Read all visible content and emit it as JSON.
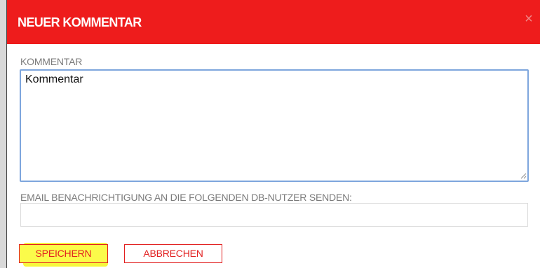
{
  "dialog": {
    "title": "NEUER KOMMENTAR",
    "close_icon": "×",
    "colors": {
      "header": "#ee1c1c",
      "accent": "#e21f1f",
      "focus_border": "#7ea6dd",
      "highlight": "#f7f73c"
    }
  },
  "comment": {
    "label": "KOMMENTAR",
    "value": "Kommentar"
  },
  "email": {
    "label": "EMAIL BENACHRICHTIGUNG AN DIE FOLGENDEN DB-NUTZER SENDEN:",
    "value": ""
  },
  "buttons": {
    "save_label": "SPEICHERN",
    "cancel_label": "ABBRECHEN"
  }
}
